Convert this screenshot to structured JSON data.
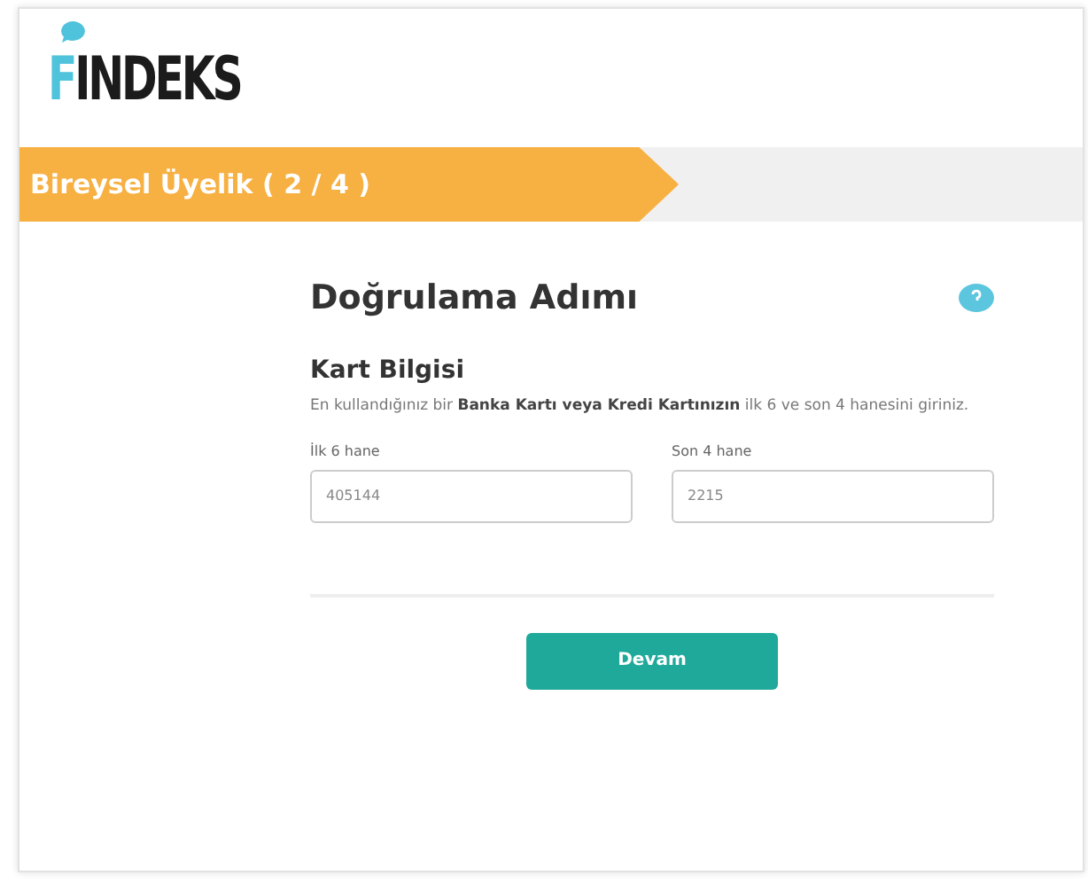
{
  "logo": {
    "text": "FINDEKS"
  },
  "banner": {
    "title": "Bireysel Üyelik ( 2 / 4 )"
  },
  "form": {
    "title": "Doğrulama Adımı",
    "section_title": "Kart Bilgisi",
    "description": "En kullandığınız bir **Banka Kartı veya Kredi Kartınızın** ilk 6 ve son 4 hanesini giriniz.",
    "fields": [
      {
        "label": "İlk 6 hane",
        "value": "405144"
      },
      {
        "label": "Son 4 hane",
        "value": "2215"
      }
    ],
    "button": "Devam"
  }
}
